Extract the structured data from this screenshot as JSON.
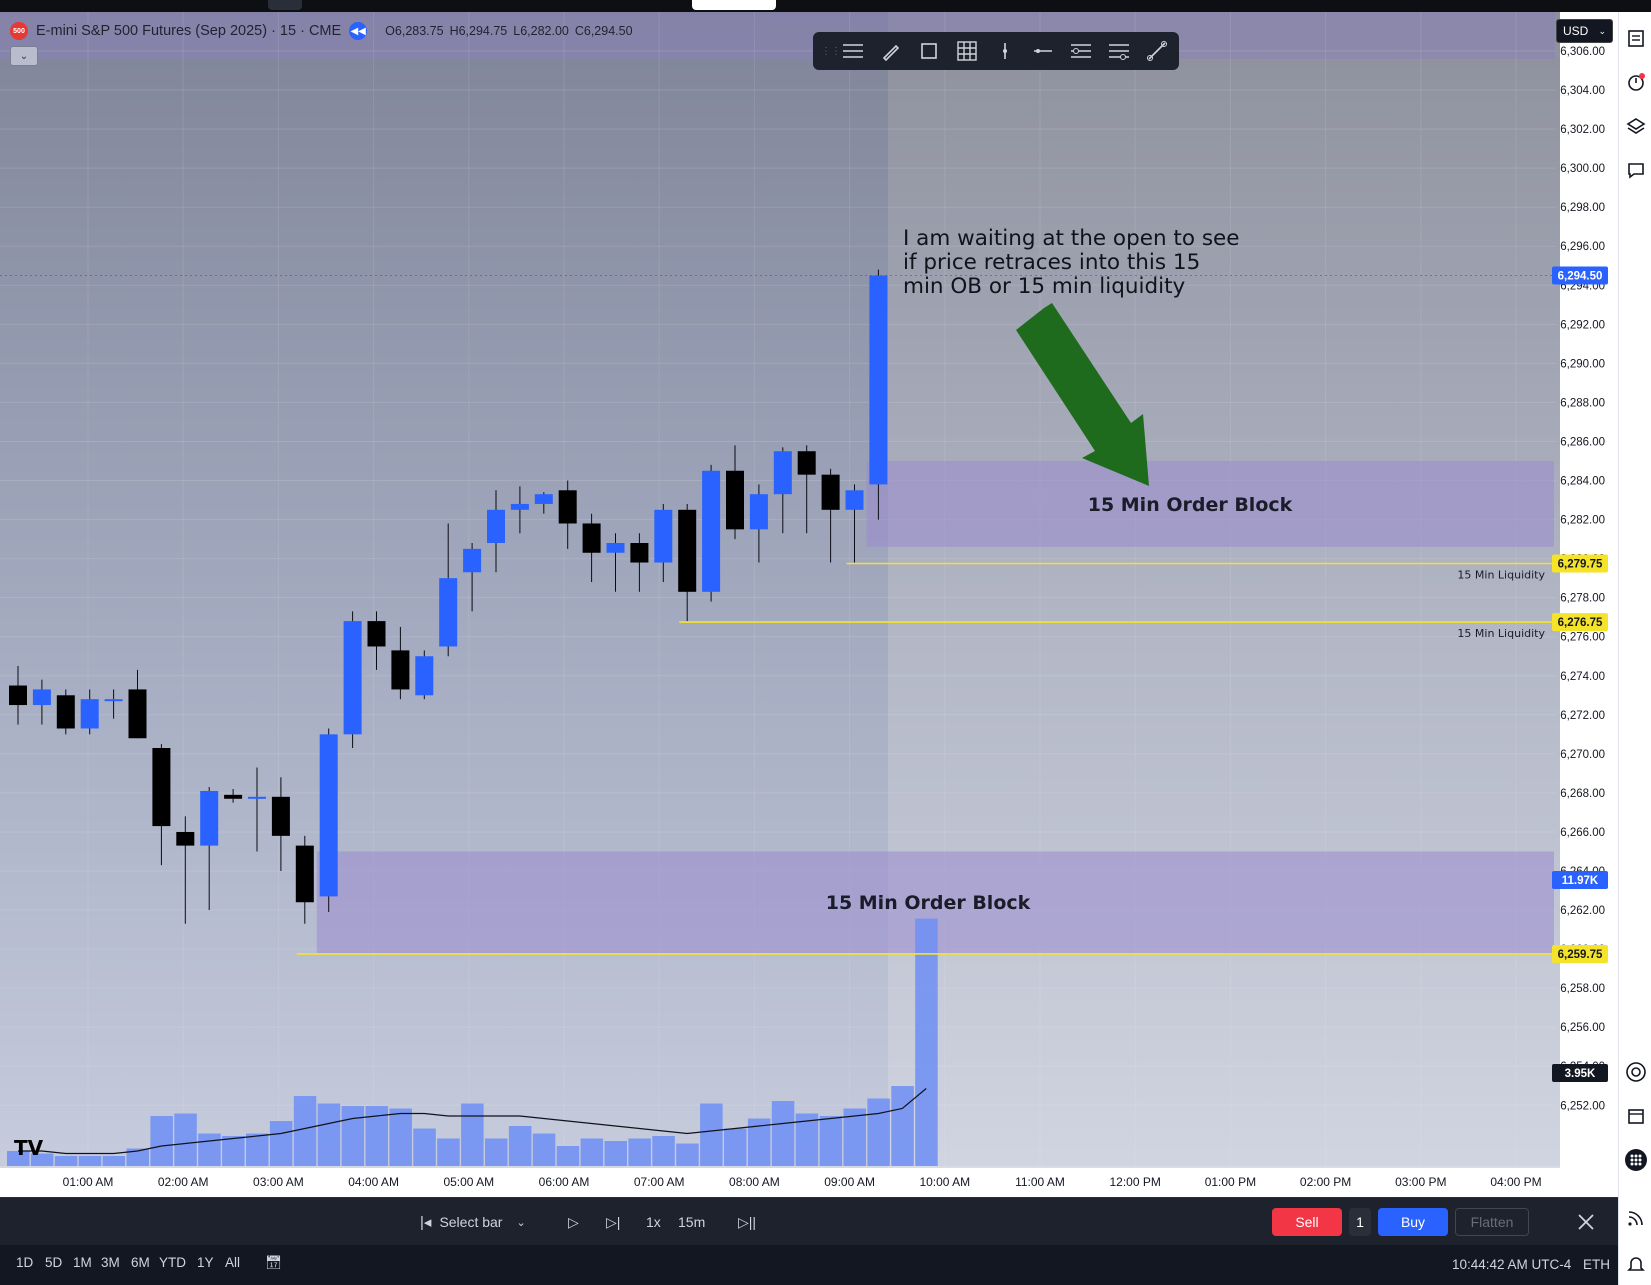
{
  "symbol": {
    "badge": "500",
    "title": "E-mini S&P 500 Futures (Sep 2025) · 15 · CME",
    "ohlc": {
      "open": "O6,283.75",
      "high": "H6,294.75",
      "low": "L6,282.00",
      "close": "C6,294.50"
    }
  },
  "currency": "USD",
  "toolbar_icons": [
    "lines-icon",
    "brush-icon",
    "rectangle-icon",
    "grid-icon",
    "vertical-line-icon",
    "horizontal-line-icon",
    "settings-lines-icon",
    "more-lines-icon",
    "ruler-icon"
  ],
  "colors": {
    "up": "#2962ff",
    "down": "#000000",
    "volume": "#6d8ef5",
    "order_block": "#9b8ad0",
    "liquidity": "#f5e32a",
    "arrow": "#1e6b1e",
    "last_price": "#2962ff"
  },
  "chart_data": {
    "type": "candlestick",
    "annotation": "I am waiting at the open to see if price retraces into this 15 min OB or 15 min liquidity",
    "y_axis": {
      "range": [
        6251,
        6307
      ],
      "ticks": [
        "6,306.00",
        "6,304.00",
        "6,302.00",
        "6,300.00",
        "6,298.00",
        "6,296.00",
        "6,294.00",
        "6,292.00",
        "6,290.00",
        "6,288.00",
        "6,286.00",
        "6,284.00",
        "6,282.00",
        "6,280.00",
        "6,278.00",
        "6,276.00",
        "6,274.00",
        "6,272.00",
        "6,270.00",
        "6,268.00",
        "6,266.00",
        "6,264.00",
        "6,262.00",
        "6,260.00",
        "6,258.00",
        "6,256.00",
        "6,254.00",
        "6,252.00"
      ]
    },
    "x_axis": {
      "ticks": [
        "01:00 AM",
        "02:00 AM",
        "03:00 AM",
        "04:00 AM",
        "05:00 AM",
        "06:00 AM",
        "07:00 AM",
        "08:00 AM",
        "09:00 AM",
        "10:00 AM",
        "11:00 AM",
        "12:00 PM",
        "01:00 PM",
        "02:00 PM",
        "03:00 PM",
        "04:00 PM"
      ]
    },
    "candles": [
      {
        "o": 6273.5,
        "h": 6274.5,
        "l": 6271.5,
        "c": 6272.5
      },
      {
        "o": 6272.5,
        "h": 6273.8,
        "l": 6271.5,
        "c": 6273.3
      },
      {
        "o": 6273.0,
        "h": 6273.3,
        "l": 6271.0,
        "c": 6271.3
      },
      {
        "o": 6271.3,
        "h": 6273.3,
        "l": 6271.0,
        "c": 6272.8
      },
      {
        "o": 6272.8,
        "h": 6273.3,
        "l": 6271.8,
        "c": 6272.8
      },
      {
        "o": 6273.3,
        "h": 6274.3,
        "l": 6270.8,
        "c": 6270.8
      },
      {
        "o": 6270.3,
        "h": 6270.5,
        "l": 6264.3,
        "c": 6266.3
      },
      {
        "o": 6266.0,
        "h": 6266.8,
        "l": 6261.3,
        "c": 6265.3
      },
      {
        "o": 6265.3,
        "h": 6268.3,
        "l": 6262.0,
        "c": 6268.1
      },
      {
        "o": 6267.9,
        "h": 6268.2,
        "l": 6267.5,
        "c": 6267.7
      },
      {
        "o": 6267.8,
        "h": 6269.3,
        "l": 6265.0,
        "c": 6267.8
      },
      {
        "o": 6267.8,
        "h": 6268.8,
        "l": 6264.0,
        "c": 6265.8
      },
      {
        "o": 6265.3,
        "h": 6265.8,
        "l": 6261.3,
        "c": 6262.4
      },
      {
        "o": 6262.7,
        "h": 6271.3,
        "l": 6261.9,
        "c": 6271.0
      },
      {
        "o": 6271.0,
        "h": 6277.3,
        "l": 6270.3,
        "c": 6276.8
      },
      {
        "o": 6276.8,
        "h": 6277.3,
        "l": 6274.3,
        "c": 6275.5
      },
      {
        "o": 6275.3,
        "h": 6276.5,
        "l": 6272.8,
        "c": 6273.3
      },
      {
        "o": 6273.0,
        "h": 6275.3,
        "l": 6272.8,
        "c": 6275.0
      },
      {
        "o": 6275.5,
        "h": 6281.8,
        "l": 6275.0,
        "c": 6279.0
      },
      {
        "o": 6279.3,
        "h": 6280.8,
        "l": 6277.3,
        "c": 6280.5
      },
      {
        "o": 6280.8,
        "h": 6283.5,
        "l": 6279.3,
        "c": 6282.5
      },
      {
        "o": 6282.5,
        "h": 6283.7,
        "l": 6281.3,
        "c": 6282.8
      },
      {
        "o": 6282.8,
        "h": 6283.4,
        "l": 6282.3,
        "c": 6283.3
      },
      {
        "o": 6283.5,
        "h": 6284.0,
        "l": 6280.5,
        "c": 6281.8
      },
      {
        "o": 6281.8,
        "h": 6282.3,
        "l": 6278.8,
        "c": 6280.3
      },
      {
        "o": 6280.3,
        "h": 6281.3,
        "l": 6278.3,
        "c": 6280.8
      },
      {
        "o": 6280.8,
        "h": 6281.3,
        "l": 6278.3,
        "c": 6279.8
      },
      {
        "o": 6279.8,
        "h": 6282.8,
        "l": 6278.8,
        "c": 6282.5
      },
      {
        "o": 6282.5,
        "h": 6282.8,
        "l": 6276.8,
        "c": 6278.3
      },
      {
        "o": 6278.3,
        "h": 6284.8,
        "l": 6277.8,
        "c": 6284.5
      },
      {
        "o": 6284.5,
        "h": 6285.8,
        "l": 6281.0,
        "c": 6281.5
      },
      {
        "o": 6281.5,
        "h": 6283.8,
        "l": 6279.8,
        "c": 6283.3
      },
      {
        "o": 6283.3,
        "h": 6285.7,
        "l": 6281.3,
        "c": 6285.5
      },
      {
        "o": 6285.5,
        "h": 6285.8,
        "l": 6281.3,
        "c": 6284.3
      },
      {
        "o": 6284.3,
        "h": 6284.6,
        "l": 6279.8,
        "c": 6282.5
      },
      {
        "o": 6282.5,
        "h": 6283.8,
        "l": 6279.8,
        "c": 6283.5
      },
      {
        "o": 6283.8,
        "h": 6294.8,
        "l": 6282.0,
        "c": 6294.5
      }
    ],
    "volume": [
      6,
      5,
      4,
      4,
      4,
      7,
      20,
      21,
      13,
      12,
      13,
      18,
      28,
      25,
      24,
      24,
      23,
      15,
      11,
      25,
      11,
      16,
      13,
      8,
      11,
      10,
      11,
      12,
      9,
      25,
      15,
      19,
      26,
      21,
      20,
      23,
      27,
      32,
      99
    ],
    "volume_ma": [
      6,
      6,
      5,
      5,
      5,
      6,
      8,
      9,
      10,
      11,
      12,
      13,
      15,
      17,
      19,
      20,
      21,
      21,
      20,
      20,
      20,
      20,
      19,
      18,
      17,
      16,
      15,
      14,
      13,
      14,
      15,
      16,
      17,
      18,
      19,
      20,
      21,
      23,
      31
    ],
    "zones": [
      {
        "label": "15 Min Order Block",
        "top": 6285.0,
        "bottom": 6280.6,
        "from_index": 35.5
      },
      {
        "label": "15 Min Order Block",
        "top": 6265.0,
        "bottom": 6259.8,
        "from_index": 12.5
      }
    ],
    "liquidity_lines": [
      {
        "label": "15 Min Liquidity",
        "value": 6279.75,
        "from_index": 35,
        "badge": "6,279.75"
      },
      {
        "label": "15 Min Liquidity",
        "value": 6276.75,
        "from_index": 28,
        "badge": "6,276.75"
      },
      {
        "label": "",
        "value": 6259.75,
        "from_index": 12,
        "badge": "6,259.75"
      }
    ],
    "last_price": {
      "value": 6294.5,
      "badge": "6,294.50"
    },
    "volume_badges": {
      "volume": "11.97K",
      "ma": "3.95K"
    }
  },
  "bottom_bar": {
    "select_bar": "Select bar",
    "speed": "1x",
    "interval": "15m",
    "sell": "Sell",
    "qty": "1",
    "buy": "Buy",
    "flatten": "Flatten"
  },
  "range_bar": {
    "ranges": [
      "1D",
      "5D",
      "1M",
      "3M",
      "6M",
      "YTD",
      "1Y",
      "All"
    ],
    "clock": "10:44:42 AM UTC-4",
    "session": "ETH"
  },
  "logo_text": "TV"
}
